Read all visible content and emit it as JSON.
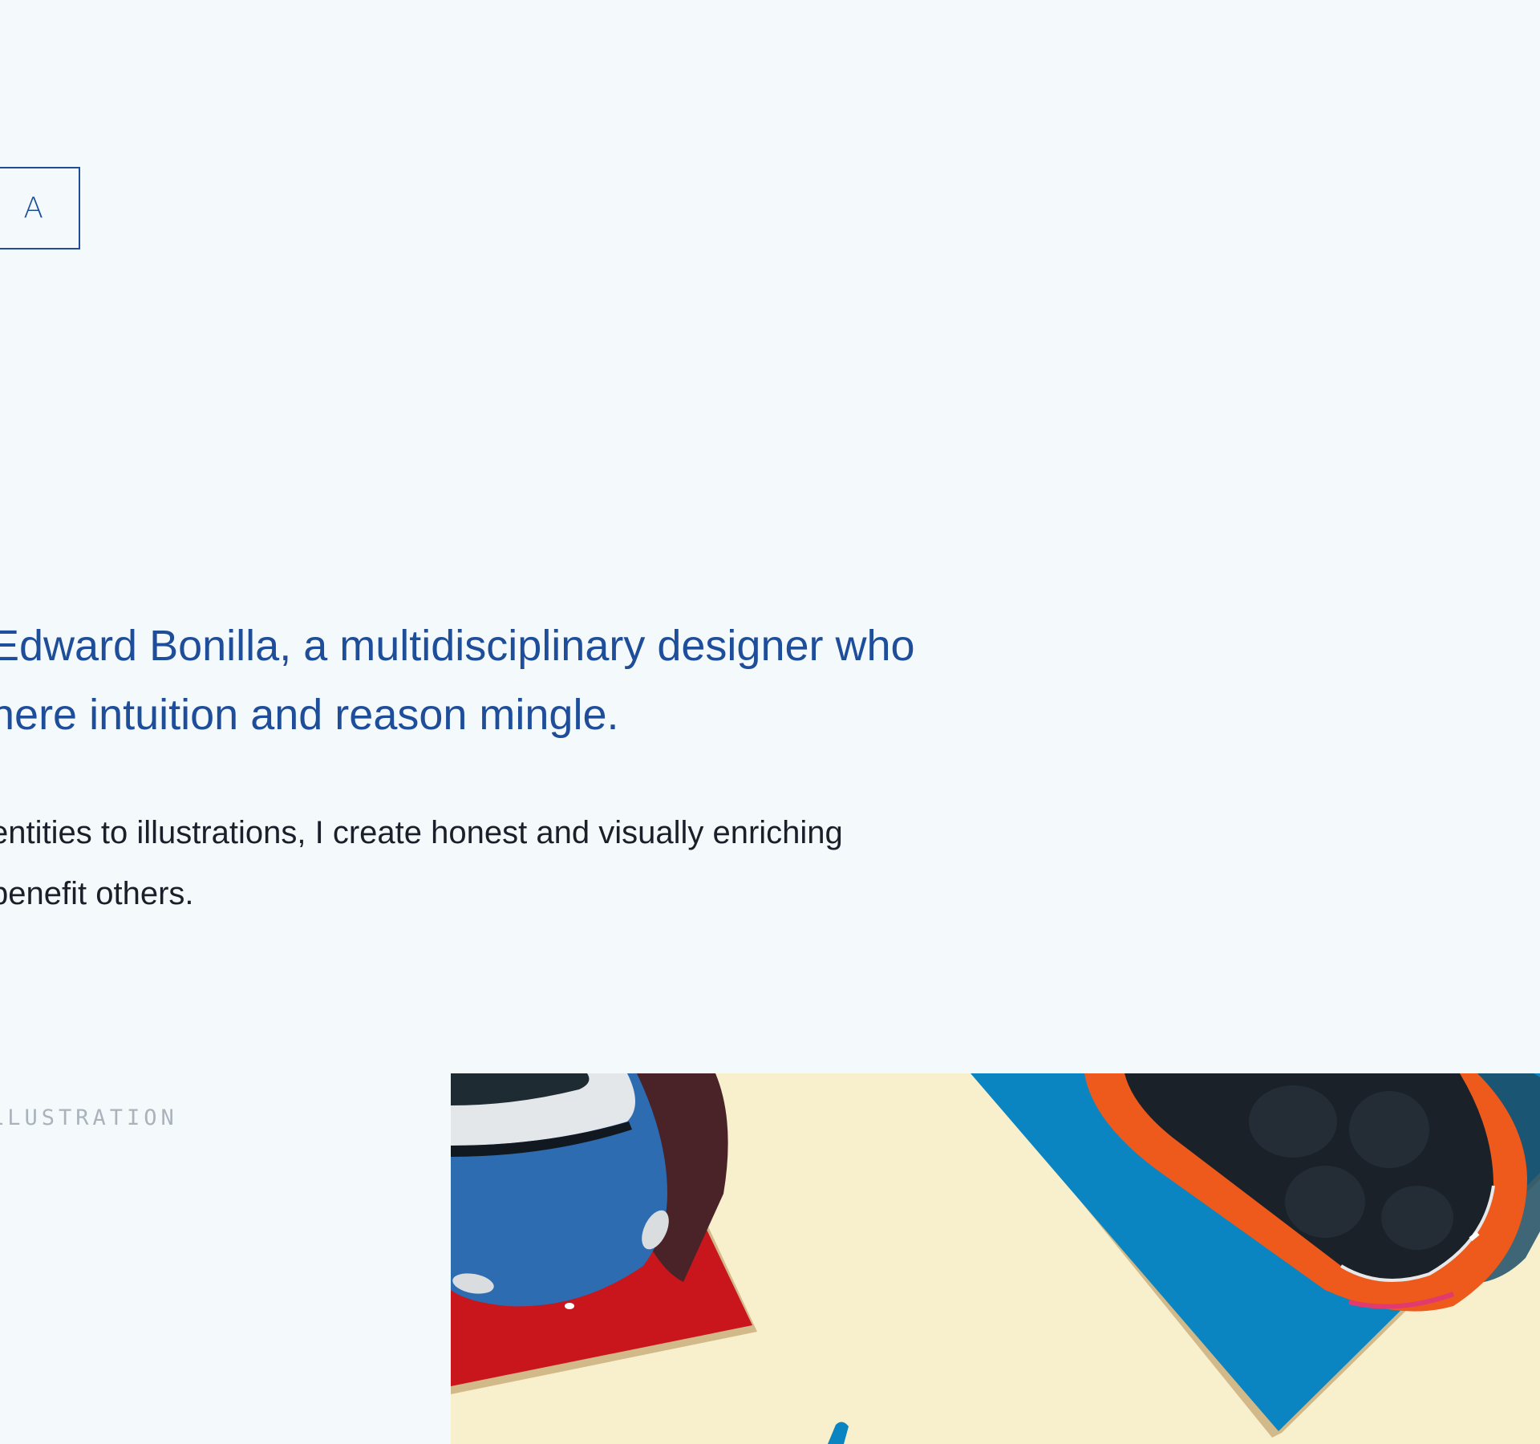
{
  "logo": {
    "text": "R A"
  },
  "hero": {
    "headline_line1": "Edward Bonilla, a multidisciplinary designer who",
    "headline_line2": "here intuition and reason mingle.",
    "body_line1": "entities to illustrations, I create honest and visually enriching",
    "body_line2": "benefit others."
  },
  "portfolio": {
    "section_label": "LLUSTRATION",
    "artwork_icon": "illustration-cars-parking"
  },
  "colors": {
    "background": "#f4f9fc",
    "accent": "#1e4d9a",
    "body_text": "#1b1f2a",
    "muted_label": "#aab3bb",
    "art_cream": "#f8f0cc",
    "art_red": "#c8161c",
    "art_blue": "#0a85c2",
    "art_orange": "#ee5a1c"
  }
}
